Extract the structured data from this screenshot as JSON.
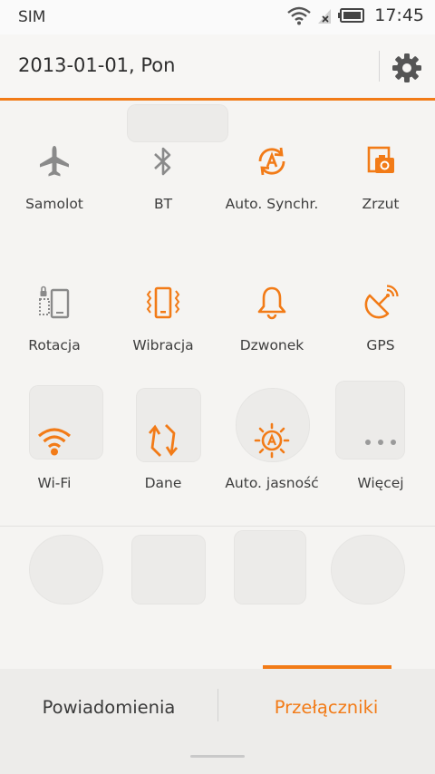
{
  "status_bar": {
    "carrier": "SIM",
    "time": "17:45",
    "icons": [
      "wifi-icon",
      "no-signal-icon",
      "battery-icon"
    ]
  },
  "header": {
    "date": "2013-01-01, Pon",
    "settings_icon": "gear-icon"
  },
  "colors": {
    "accent": "#f27b17",
    "inactive": "#8a8a8a"
  },
  "toggles": [
    {
      "label": "Samolot",
      "icon": "airplane-icon",
      "active": false
    },
    {
      "label": "BT",
      "icon": "bluetooth-icon",
      "active": false
    },
    {
      "label": "Auto. Synchr.",
      "icon": "sync-icon",
      "active": true
    },
    {
      "label": "Zrzut",
      "icon": "screenshot-icon",
      "active": true
    },
    {
      "label": "Rotacja",
      "icon": "rotation-lock-icon",
      "active": false
    },
    {
      "label": "Wibracja",
      "icon": "vibrate-icon",
      "active": true
    },
    {
      "label": "Dzwonek",
      "icon": "bell-icon",
      "active": true
    },
    {
      "label": "GPS",
      "icon": "gps-icon",
      "active": true
    },
    {
      "label": "Wi-Fi",
      "icon": "wifi-icon",
      "active": true
    },
    {
      "label": "Dane",
      "icon": "data-icon",
      "active": true
    },
    {
      "label": "Auto. jasność",
      "icon": "auto-brightness-icon",
      "active": true
    },
    {
      "label": "Więcej",
      "icon": "more-icon",
      "active": false
    }
  ],
  "tabs": {
    "notifications": "Powiadomienia",
    "toggles": "Przełączniki",
    "active": "toggles"
  }
}
